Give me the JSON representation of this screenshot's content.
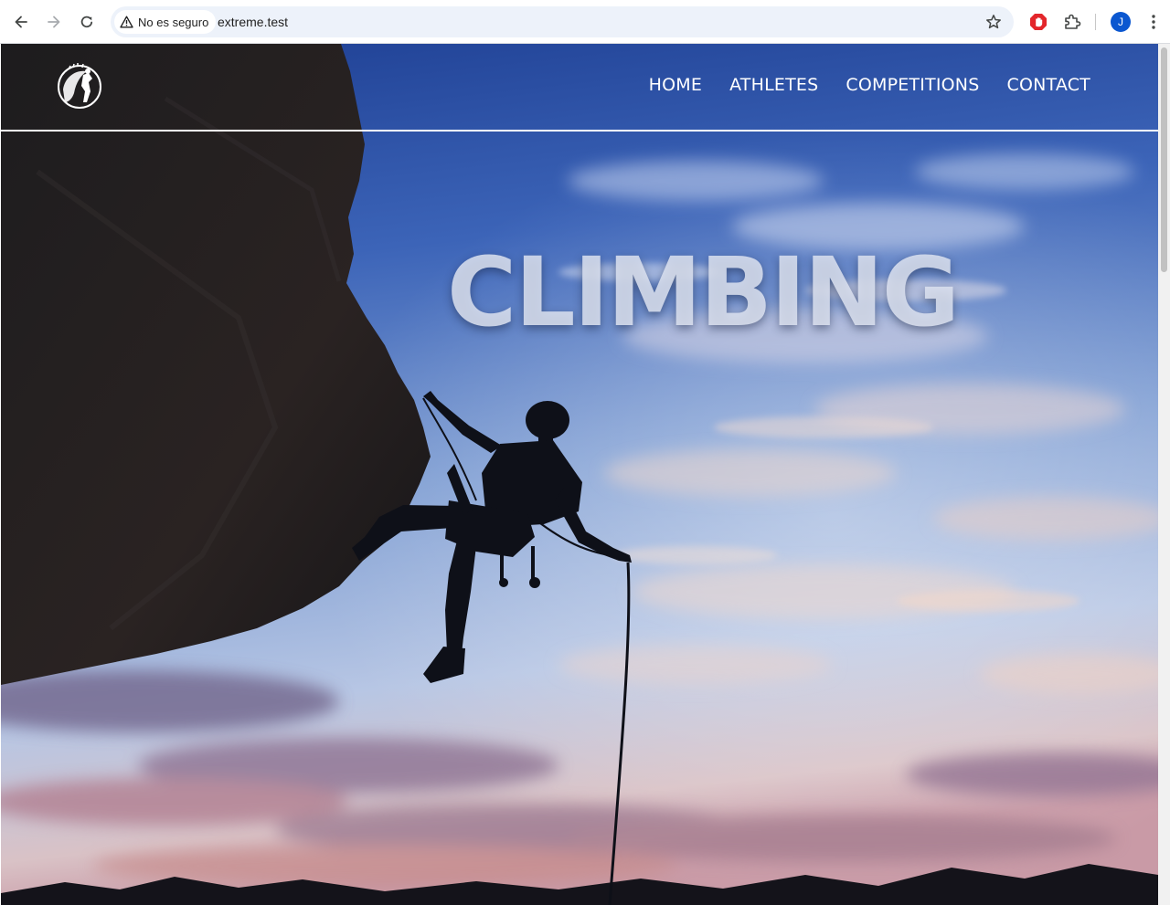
{
  "browser": {
    "security_label": "No es seguro",
    "url": "extreme.test",
    "profile_initial": "J",
    "icons": {
      "back": "arrow-left-icon",
      "forward": "arrow-right-icon",
      "reload": "reload-icon",
      "security": "warning-triangle-icon",
      "bookmark": "star-outline-icon",
      "adblock_extension": "red-hand-stop-icon",
      "extensions": "puzzle-piece-icon",
      "menu": "vertical-dots-icon"
    },
    "colors": {
      "omnibox": "#edf2fa",
      "avatar": "#0b57d0",
      "adblock": "#e3262b"
    }
  },
  "site": {
    "logo_icon": "climber-emblem-icon",
    "nav": [
      {
        "label": "HOME"
      },
      {
        "label": "ATHLETES"
      },
      {
        "label": "COMPETITIONS"
      },
      {
        "label": "CONTACT"
      }
    ],
    "hero": {
      "title": "CLIMBING",
      "background": "climber-silhouette-on-overhang-at-sunset-sky"
    }
  }
}
